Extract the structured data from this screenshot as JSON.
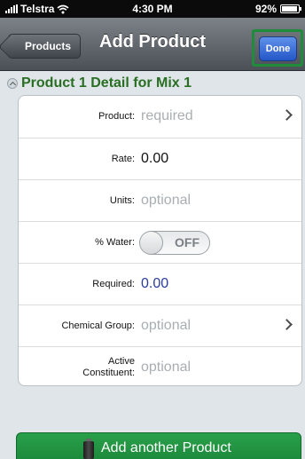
{
  "status_bar": {
    "carrier": "Telstra",
    "time": "4:30 PM",
    "battery": "92%",
    "battery_level": 0.92
  },
  "nav": {
    "back_label": "Products",
    "title": "Add Product",
    "done_label": "Done"
  },
  "section": {
    "title": "Product 1 Detail for Mix 1"
  },
  "rows": [
    {
      "label": "Product:",
      "value": "required",
      "has_chevron": true
    },
    {
      "label": "Rate:",
      "value": "0.00"
    },
    {
      "label": "Units:",
      "value": "optional"
    },
    {
      "label": "% Water:",
      "toggle": "OFF"
    },
    {
      "label": "Required:",
      "value": "0.00"
    },
    {
      "label": "Chemical Group:",
      "value": "optional",
      "has_chevron": true
    },
    {
      "label_line1": "Active",
      "label_line2": "Constituent:",
      "value": "optional"
    }
  ],
  "add_button": {
    "label": "Add another Product"
  },
  "colors": {
    "section_title": "#2a6e24",
    "done_button": "#2456c8",
    "done_highlight": "#1e8c3a",
    "add_button": "#1f9140",
    "required_value": "#2b3c9c"
  }
}
